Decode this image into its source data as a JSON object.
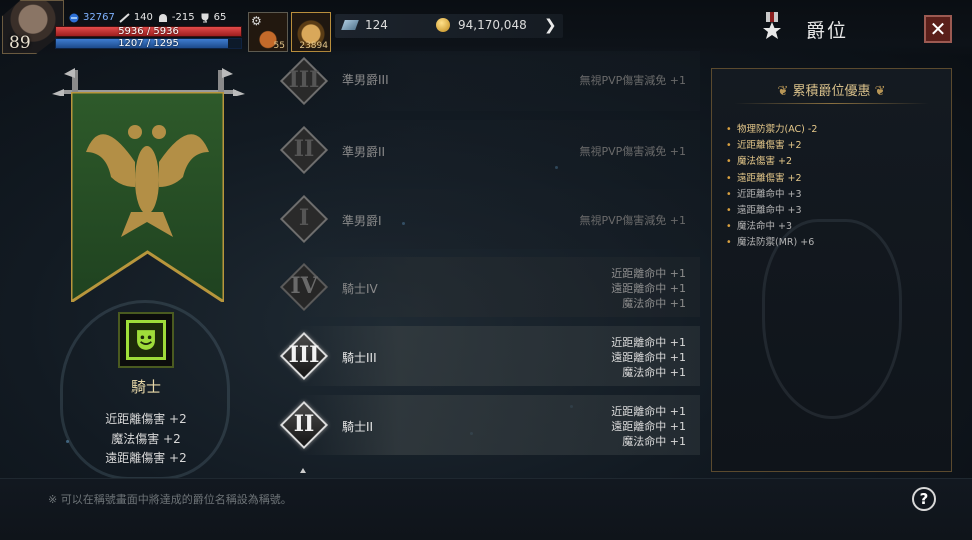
{
  "player": {
    "level": "89",
    "resources": [
      {
        "icon": "energy-icon",
        "value": "32767"
      },
      {
        "icon": "attack-icon",
        "value": "140"
      },
      {
        "icon": "helmet-icon",
        "value": "-215"
      },
      {
        "icon": "trophy-icon",
        "value": "65"
      }
    ],
    "hp_text": "5936 / 5936",
    "mp_text": "1207 / 1295",
    "mp_fraction": 0.932
  },
  "slots": {
    "slot1_count": "55",
    "slot2_count": "23894"
  },
  "currency": {
    "gems": "124",
    "gold": "94,170,048"
  },
  "header": {
    "title": "爵位",
    "close_label": "✕"
  },
  "current_rank": {
    "name": "騎士",
    "stats": [
      "近距離傷害 +2",
      "魔法傷害 +2",
      "遠距離傷害 +2"
    ]
  },
  "ranks": [
    {
      "numeral": "III",
      "name": "準男爵III",
      "bonus": [
        "無視PVP傷害減免 +1"
      ],
      "state": "dim"
    },
    {
      "numeral": "II",
      "name": "準男爵II",
      "bonus": [
        "無視PVP傷害減免 +1"
      ],
      "state": "dim"
    },
    {
      "numeral": "I",
      "name": "準男爵I",
      "bonus": [
        "無視PVP傷害減免 +1"
      ],
      "state": "dim"
    },
    {
      "numeral": "IV",
      "name": "騎士IV",
      "bonus": [
        "近距離命中 +1",
        "遠距離命中 +1",
        "魔法命中 +1"
      ],
      "state": "mid"
    },
    {
      "numeral": "III",
      "name": "騎士III",
      "bonus": [
        "近距離命中 +1",
        "遠距離命中 +1",
        "魔法命中 +1"
      ],
      "state": "lit"
    },
    {
      "numeral": "II",
      "name": "騎士II",
      "bonus": [
        "近距離命中 +1",
        "遠距離命中 +1",
        "魔法命中 +1"
      ],
      "state": "lit"
    }
  ],
  "cumulative": {
    "title": "累積爵位優惠",
    "items": [
      {
        "text": "物理防禦力(AC) -2",
        "tone": "gold"
      },
      {
        "text": "近距離傷害 +2",
        "tone": "gold"
      },
      {
        "text": "魔法傷害 +2",
        "tone": "gold"
      },
      {
        "text": "遠距離傷害 +2",
        "tone": "gold"
      },
      {
        "text": "近距離命中 +3",
        "tone": "grey"
      },
      {
        "text": "遠距離命中 +3",
        "tone": "grey"
      },
      {
        "text": "魔法命中 +3",
        "tone": "grey"
      },
      {
        "text": "魔法防禦(MR) +6",
        "tone": "grey"
      }
    ]
  },
  "footer": {
    "note": "※ 可以在稱號畫面中將達成的爵位名稱設為稱號。",
    "help_label": "?"
  }
}
